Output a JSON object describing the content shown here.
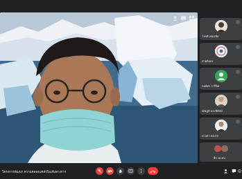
{
  "meeting": {
    "title": "โครงการพัฒนา ความคลองแคล่วในเส้นทางการวิจัยสู่ความสำเร็จ"
  },
  "participants": [
    {
      "name": "โรตตี เฟองฟ้อ"
    },
    {
      "name": "สายกิจปร"
    },
    {
      "name": "กมลิศร วารีนิต"
    },
    {
      "name": "ณัชฎธิ ธระพิทักษ์"
    },
    {
      "name": "ดวงทา ทองรก"
    }
  ],
  "others": {
    "label": "อีก 18 คน"
  },
  "icons": {
    "top_bar": [
      "people-icon",
      "chat-icon",
      "activities-icon",
      "lock-icon"
    ],
    "controls": [
      "mic-off-icon",
      "camera-off-icon",
      "raise-hand-icon",
      "present-icon",
      "more-icon",
      "hangup-icon"
    ],
    "right": [
      "info-icon",
      "people-icon",
      "chat-icon"
    ]
  },
  "colors": {
    "background": "#202124",
    "tile": "#3c4043",
    "danger": "#ea4335",
    "mask": "#8fd3d4",
    "accent_green": "#34a853"
  }
}
